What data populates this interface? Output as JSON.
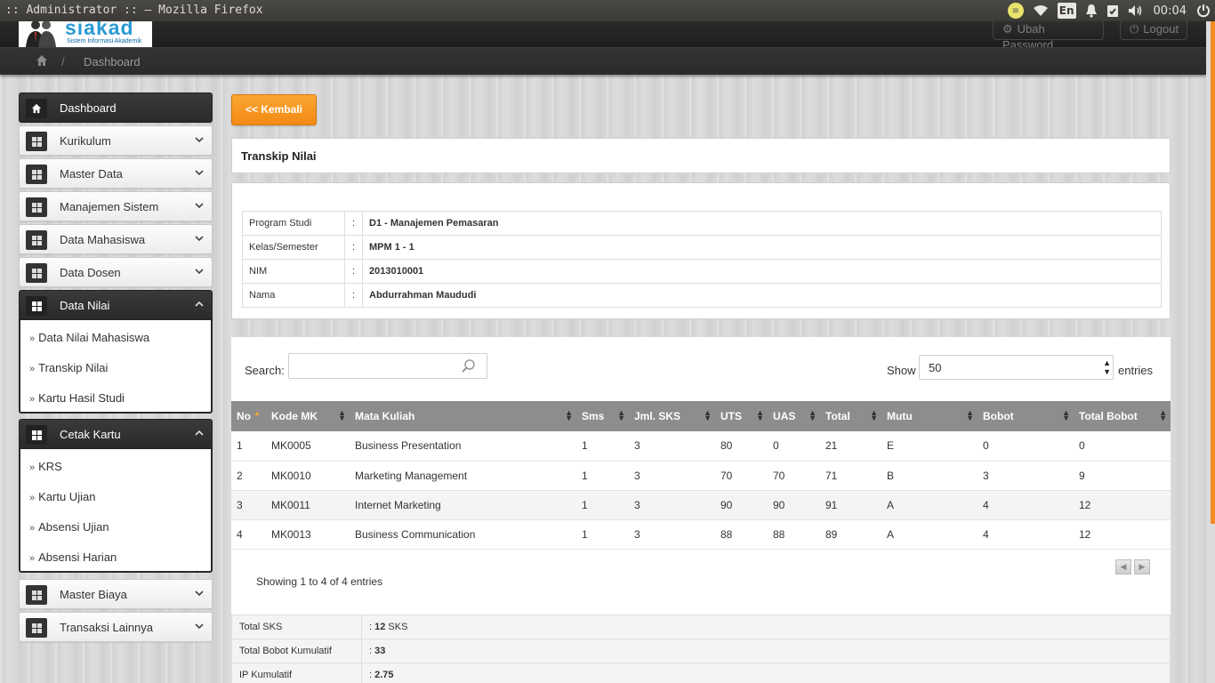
{
  "os": {
    "window_title": ":: Administrator :: – Mozilla Firefox",
    "lang": "En",
    "clock": "00:04"
  },
  "header": {
    "logo_text": "siakad",
    "logo_sub": "Sistem Informasi Akademik",
    "change_password": "Ubah Password",
    "logout": "Logout"
  },
  "breadcrumb": {
    "separator": "/",
    "current": "Dashboard"
  },
  "sidebar": {
    "items": [
      {
        "label": "Dashboard"
      },
      {
        "label": "Kurikulum"
      },
      {
        "label": "Master Data"
      },
      {
        "label": "Manajemen Sistem"
      },
      {
        "label": "Data Mahasiswa"
      },
      {
        "label": "Data Dosen"
      },
      {
        "label": "Data Nilai"
      },
      {
        "label": "Cetak Kartu"
      },
      {
        "label": "Master Biaya"
      },
      {
        "label": "Transaksi Lainnya"
      }
    ],
    "data_nilai_sub": [
      "Data Nilai Mahasiswa",
      "Transkip Nilai",
      "Kartu Hasil Studi"
    ],
    "cetak_kartu_sub": [
      "KRS",
      "Kartu Ujian",
      "Absensi Ujian",
      "Absensi Harian"
    ],
    "sub_prefix": "»"
  },
  "main": {
    "back_button": "<< Kembali",
    "title": "Transkip Nilai",
    "info": [
      {
        "key": "Program Studi",
        "sep": ":",
        "value": "D1 - Manajemen Pemasaran"
      },
      {
        "key": "Kelas/Semester",
        "sep": ":",
        "value": "MPM 1 - 1"
      },
      {
        "key": "NIM",
        "sep": ":",
        "value": "2013010001"
      },
      {
        "key": "Nama",
        "sep": ":",
        "value": "Abdurrahman Maududi"
      }
    ],
    "search_label": "Search:",
    "search_value": "",
    "show_label": "Show",
    "page_size": "50",
    "entries_label": "entries",
    "columns": [
      "No",
      "Kode MK",
      "Mata Kuliah",
      "Sms",
      "Jml. SKS",
      "UTS",
      "UAS",
      "Total",
      "Mutu",
      "Bobot",
      "Total Bobot"
    ],
    "rows": [
      [
        "1",
        "MK0005",
        "Business Presentation",
        "1",
        "3",
        "80",
        "0",
        "21",
        "E",
        "0",
        "0"
      ],
      [
        "2",
        "MK0010",
        "Marketing Management",
        "1",
        "3",
        "70",
        "70",
        "71",
        "B",
        "3",
        "9"
      ],
      [
        "3",
        "MK0011",
        "Internet Marketing",
        "1",
        "3",
        "90",
        "90",
        "91",
        "A",
        "4",
        "12"
      ],
      [
        "4",
        "MK0013",
        "Business Communication",
        "1",
        "3",
        "88",
        "88",
        "89",
        "A",
        "4",
        "12"
      ]
    ],
    "showing": "Showing 1 to 4 of 4 entries",
    "summary": [
      {
        "key": "Total SKS",
        "prefix": ": ",
        "value": "12",
        "suffix": " SKS"
      },
      {
        "key": "Total Bobot Kumulatif",
        "prefix": ": ",
        "value": "33",
        "suffix": ""
      },
      {
        "key": "IP Kumulatif",
        "prefix": ": ",
        "value": "2.75",
        "suffix": ""
      }
    ]
  },
  "colors": {
    "accent_orange": "#f28a14",
    "table_header": "#8d8d8d",
    "dark_bar": "#2a2a2a"
  }
}
